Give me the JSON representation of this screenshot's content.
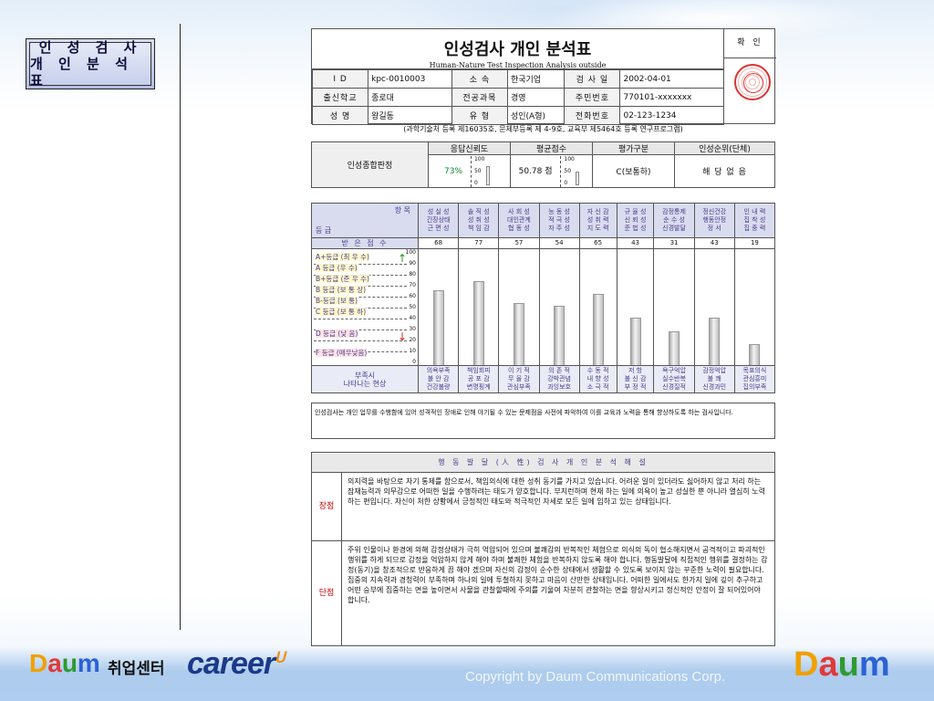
{
  "sidebar": {
    "title_line1": "인 성 검 사",
    "title_line2": "개 인 분 석 표"
  },
  "report": {
    "title": "인성검사 개인 분석표",
    "subtitle": "Human-Nature Test Inspection Analysis outside",
    "stamp_label": "확 인",
    "info_rows": [
      [
        "I D",
        "kpc-0010003",
        "소 속",
        "한국기업",
        "검 사 일",
        "2002-04-01"
      ],
      [
        "출신학교",
        "종로대",
        "전공과목",
        "경영",
        "주민번호",
        "770101-xxxxxxx"
      ],
      [
        "성 명",
        "왕길동",
        "유 형",
        "성인(A형)",
        "전화번호",
        "02-123-1234"
      ]
    ],
    "note": "(과학기술처 등록 제16035호, 문체부등록 제 4-9호, 교육부 제5464호 등록 연구프로그램)"
  },
  "summary": {
    "row_label": "인성종합판정",
    "headers": [
      "응답신뢰도",
      "평균점수",
      "평가구분",
      "인성순위(단체)"
    ],
    "reliability": "73%",
    "average": "50.78 점",
    "evaluation": "C(보통하)",
    "rank": "해 당 없 음",
    "scale": [
      "100",
      "50",
      "0"
    ],
    "reliability_fill": 0.73,
    "average_fill": 0.5078
  },
  "grid": {
    "corner_item": "항 목",
    "corner_grade": "등 급",
    "score_label": "받 은 점 수",
    "bottom_label": "부족시\n나타나는 현상",
    "columns": [
      {
        "head": "성 실 성\n긴장상태\n근 면 성",
        "score": 68,
        "low": "의욕부족\n불 안 감\n건강불량"
      },
      {
        "head": "솔 직 성\n성 취 성\n책 임 감",
        "score": 77,
        "low": "책임회피\n공 포 감\n변명핑계"
      },
      {
        "head": "사 회 성\n대인관계\n협 동 성",
        "score": 57,
        "low": "이 기 적\n무 율 감\n관심부족"
      },
      {
        "head": "능 동 성\n적 극 성\n자 주 성",
        "score": 54,
        "low": "의 존 적\n강박관념\n과잉보호"
      },
      {
        "head": "자 신 감\n성 취 력\n지 도 력",
        "score": 65,
        "low": "수 동 적\n내 향 성\n소 극 적"
      },
      {
        "head": "규 율 성\n신 뢰 성\n준 법 성",
        "score": 43,
        "low": "저    항\n불 신 감\n부 정 적"
      },
      {
        "head": "감정통제\n순 수 성\n신경발달",
        "score": 31,
        "low": "욕구억압\n실수반복\n신경질적"
      },
      {
        "head": "정신건강\n행동안정\n정    서",
        "score": 43,
        "low": "감정억압\n불    쾌\n신경과민"
      },
      {
        "head": "인 내 력\n집 착 성\n집 중 력",
        "score": 19,
        "low": "목표의식\n관심흥미\n집의부족"
      }
    ],
    "grades": [
      "A+등급 (최 우 수)",
      "A 등급 (우    수)",
      "B+등급 (준 우 수)",
      "B 등급 (보 통 상)",
      "B-등급 (보    통)",
      "C 등급 (보 통 하)",
      "D 등급 (낮    음)",
      "F 등급 (매우낮음)"
    ],
    "ticks": [
      "100",
      "90",
      "80",
      "70",
      "60",
      "50",
      "40",
      "30",
      "20",
      "10",
      "0"
    ]
  },
  "description": "인성검사는 개인 업무를 수행함에 있어 성격적인 장애로 인해 야기될 수 있는 문제점을 사전에 파악하여 이를 교육과 노력을 통해 향상하도록 하는 검사입니다.",
  "analysis": {
    "caption": "행 동 발 달 (人 性) 검 사 개 인 분 석 해 설",
    "strength_label": "장점",
    "strength_text": "의지력을 바탕으로 자기 통제를 함으로서, 책임의식에 대한 성취 동기를 가지고 있습니다. 어려운 일이 있더라도 싫어하지 않고 처리 하는 잠재능력과 의무감으로 어떠한 일을 수행하려는 태도가 양호합니다. 부지런하며 현재 하는 일에 의욕이 높고 성실한 뿐 아니라 열심히 노력하는 편입니다. 자신이 처한 상황에서 긍정적인 태도와 적극적인 자세로 모든 일에 임하고 있는 상태입니다.",
    "weakness_label": "단점",
    "weakness_text": "주위 인물이나 환경에 의해 감정상태가 극히 억압되어 있으며 불쾌감의 반복적인 체험으로 의식의 독이 협소해지면서 공격적이고 파괴적인 행위를 하게 되므로 감정을 억압하지 않게 해야 하며 불쾌한 체험을 반복하지 않도록 해야 합니다. 행동발달에 직접적인 행위를 결정하는 감정(동기)을 창조적으로 반응하게 끔 해야 겠으며 자신의 감정이 순수한 상태에서 생활할 수 있도록 보이지 않는 꾸준한 노력이 필요합니다. 집중의 지속력과 경청력이 부족하며 하나의 일에 투철하지 못하고 마음이 산만한 상태입니다. 어떠한 일에서도 한가지 일에 깊이 추구하고 어떤 승부에 집중하는 면을 높이면서 사물을 관찰할때에 주의를 기울여 차분히 관찰하는 면을 향상시키고 정신적인 안정이 잘 되어있어야 합니다."
  },
  "footer": {
    "daum_logo": "Daum",
    "center_label": "취업센터",
    "career_logo": "career",
    "copyright": "Copyright by Daum Communications Corp."
  }
}
